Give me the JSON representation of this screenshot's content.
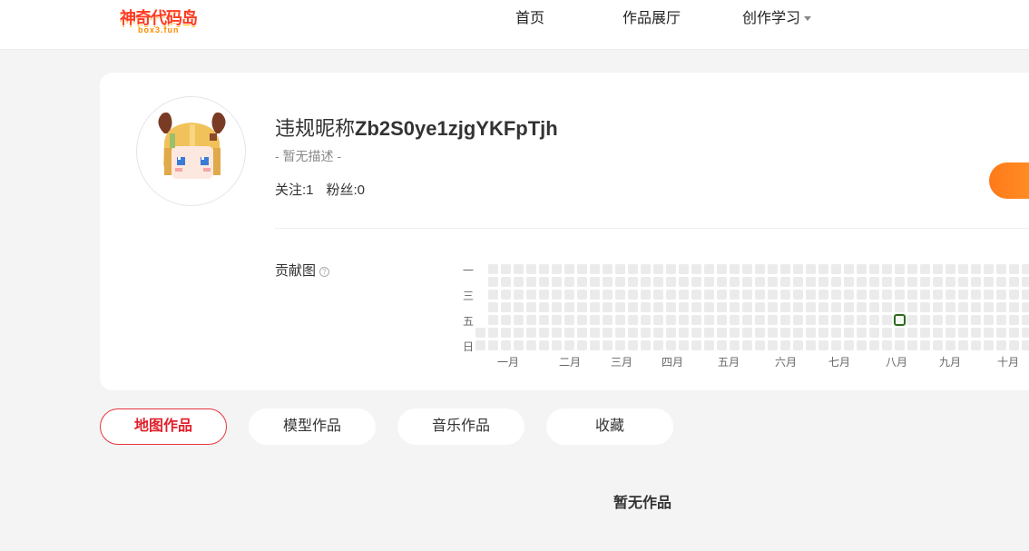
{
  "header": {
    "logo_text": "神奇代码岛",
    "logo_sub": "box3.fun",
    "nav": [
      {
        "label": "首页"
      },
      {
        "label": "作品展厅"
      },
      {
        "label": "创作学习"
      }
    ]
  },
  "profile": {
    "nickname_cn": "违规昵称",
    "nickname_id": "Zb2S0ye1zjgYKFpTjh",
    "description": "- 暂无描述 -",
    "following_label": "关注:1",
    "followers_label": "粉丝:0",
    "contrib_label": "贡献图",
    "weekdays": [
      "一",
      "三",
      "五",
      "日"
    ],
    "months": [
      "一月",
      "二月",
      "三月",
      "四月",
      "五月",
      "六月",
      "七月",
      "八月",
      "九月",
      "十月"
    ],
    "contributions": {
      "active_cells": [
        {
          "week": 33,
          "day": 4
        }
      ]
    }
  },
  "tabs": [
    {
      "label": "地图作品",
      "active": true
    },
    {
      "label": "模型作品",
      "active": false
    },
    {
      "label": "音乐作品",
      "active": false
    },
    {
      "label": "收藏",
      "active": false
    }
  ],
  "empty_text": "暂无作品",
  "colors": {
    "accent": "#e0212c",
    "follow_button": "#ff7a1a",
    "contrib_active": "#2f6a1d"
  },
  "icons": {
    "help": "?"
  }
}
